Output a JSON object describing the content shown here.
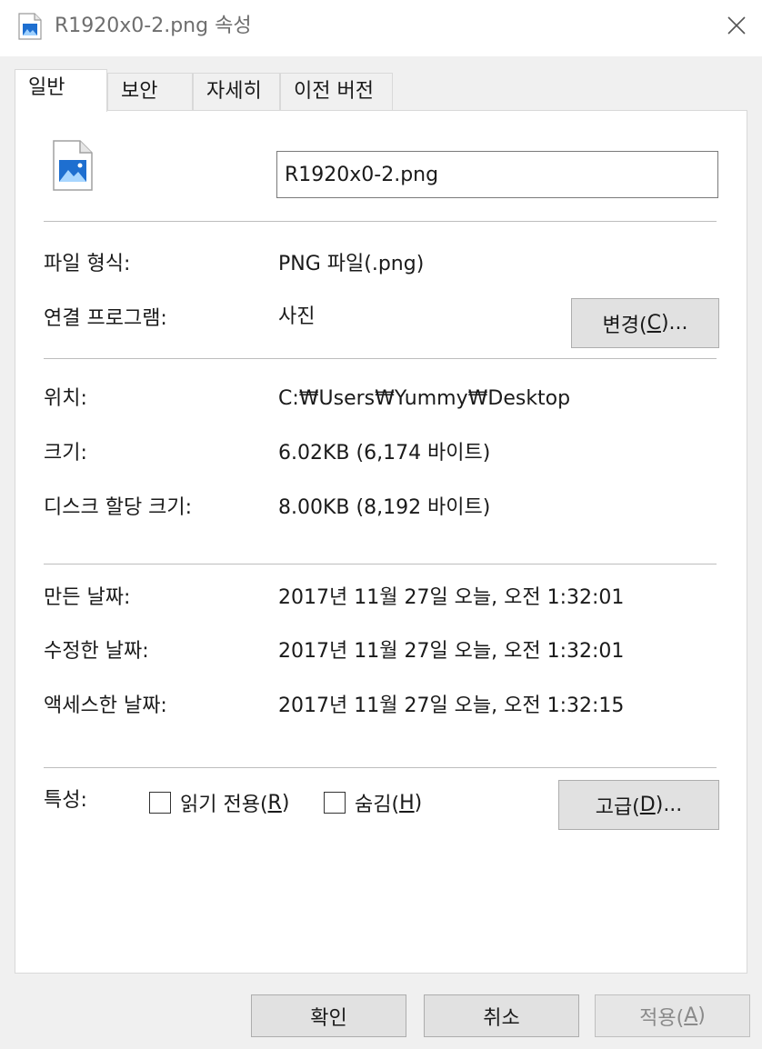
{
  "window": {
    "title": "R1920x0-2.png 속성"
  },
  "tabs": [
    {
      "label": "일반"
    },
    {
      "label": "보안"
    },
    {
      "label": "자세히"
    },
    {
      "label": "이전 버전"
    }
  ],
  "general": {
    "file_name": "R1920x0-2.png",
    "file_type_label": "파일 형식:",
    "file_type_value": "PNG 파일(.png)",
    "opens_with_label": "연결 프로그램:",
    "opens_with_value": "사진",
    "change_button": {
      "text": "변경(",
      "key": "C",
      "suffix": ")..."
    },
    "location_label": "위치:",
    "location_value": "C:₩Users₩Yummy₩Desktop",
    "size_label": "크기:",
    "size_value": "6.02KB (6,174 바이트)",
    "size_on_disk_label": "디스크 할당 크기:",
    "size_on_disk_value": "8.00KB (8,192 바이트)",
    "created_label": "만든 날짜:",
    "created_value": "2017년 11월 27일 오늘, 오전 1:32:01",
    "modified_label": "수정한 날짜:",
    "modified_value": "2017년 11월 27일 오늘, 오전 1:32:01",
    "accessed_label": "액세스한 날짜:",
    "accessed_value": "2017년 11월 27일 오늘, 오전 1:32:15",
    "attributes_label": "특성:",
    "readonly": {
      "text": "읽기 전용(",
      "key": "R",
      "suffix": ")",
      "checked": false
    },
    "hidden": {
      "text": "숨김(",
      "key": "H",
      "suffix": ")",
      "checked": false
    },
    "advanced_button": {
      "text": "고급(",
      "key": "D",
      "suffix": ")..."
    }
  },
  "footer": {
    "ok_label": "확인",
    "cancel_label": "취소",
    "apply": {
      "text": "적용(",
      "key": "A",
      "suffix": ")"
    }
  },
  "icons": {
    "title_icon": "image-file-icon",
    "file_icon": "image-file-icon",
    "close_icon": "close-icon"
  },
  "colors": {
    "accent_image_blue": "#1e6fd0",
    "window_bg": "#f0f0f0",
    "panel_bg": "#ffffff"
  }
}
